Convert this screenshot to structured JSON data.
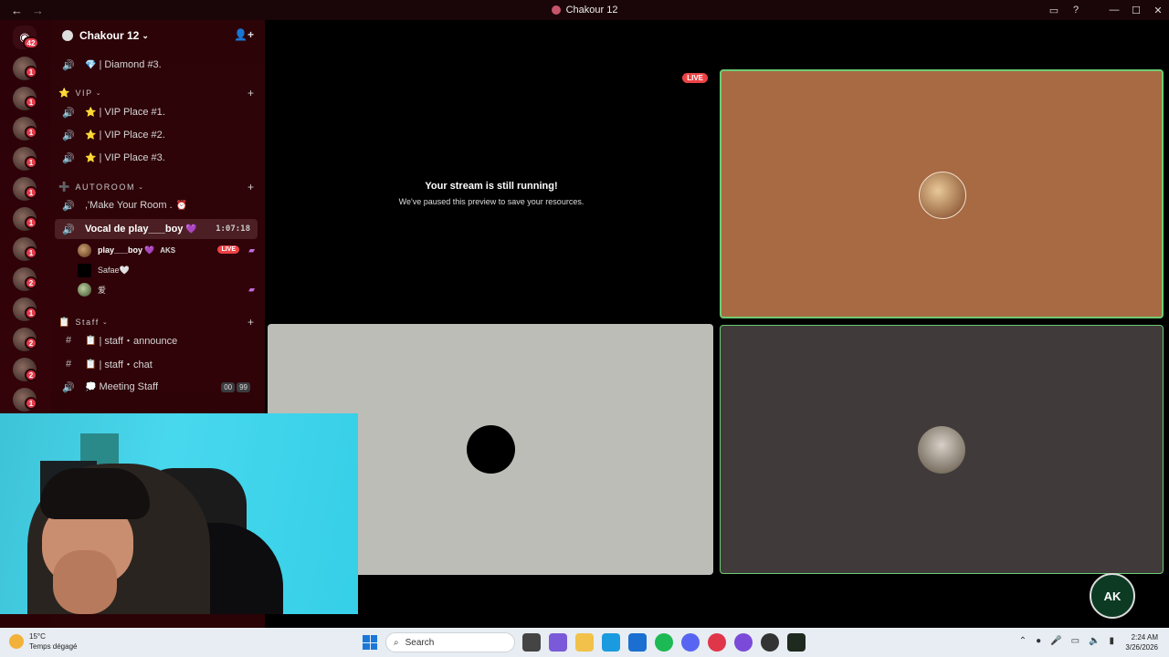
{
  "window": {
    "title": "Chakour 12",
    "nav_back": "←",
    "nav_forward": "→"
  },
  "rail": {
    "home_badge": "42",
    "badges": [
      "1",
      "1",
      "1",
      "1",
      "1",
      "1",
      "1",
      "1",
      "2",
      "1",
      "2",
      "2",
      "1"
    ]
  },
  "server": {
    "name": "Chakour 12",
    "channels_top": [
      {
        "label": "| Diamond #3.",
        "emoji": "💎"
      }
    ],
    "categories": {
      "vip": {
        "label": "VIP",
        "emoji": "⭐"
      },
      "autoroom": {
        "label": "AUTOROOM",
        "emoji": "➕"
      },
      "staff": {
        "label": "Staff",
        "emoji": "📋"
      }
    },
    "vip_channels": [
      {
        "label": "| VIP Place #1.",
        "emoji": "⭐"
      },
      {
        "label": "| VIP Place #2.",
        "emoji": "⭐"
      },
      {
        "label": "| VIP Place #3.",
        "emoji": "⭐"
      }
    ],
    "autoroom_channels": [
      {
        "label": ",'Make Your Room .",
        "emoji": "⏰"
      }
    ],
    "active_channel": {
      "label": "Vocal de play___boy",
      "emoji": "💜",
      "timer": "1:07:18"
    },
    "voice_users": [
      {
        "name": "play___boy",
        "emoji": "💜",
        "tag": "AKS",
        "live": "LIVE"
      },
      {
        "name": "Safae🤍"
      },
      {
        "name": "爱"
      }
    ],
    "staff_channels": [
      {
        "label": "| staff・announce",
        "emoji": "📋"
      },
      {
        "label": "| staff・chat",
        "emoji": "📋"
      }
    ],
    "meeting": {
      "label": "Meeting Staff",
      "emoji": "💭",
      "count_a": "00",
      "count_b": "99"
    }
  },
  "stream": {
    "live_label": "LIVE",
    "heading": "Your stream is still running!",
    "subtext": "We've paused this preview to save your resources."
  },
  "overlay_logo": "AK",
  "taskbar": {
    "temp": "15°C",
    "weather": "Temps dégagé",
    "search_placeholder": "Search",
    "time": "2:24 AM",
    "date": "3/26/2026"
  },
  "colors": {
    "accent_live": "#ed4245",
    "speaking_border": "#6dcc73",
    "tile_orange": "#a86a42",
    "tile_gray": "#bdbdb8",
    "tile_dark": "#403a3a"
  }
}
